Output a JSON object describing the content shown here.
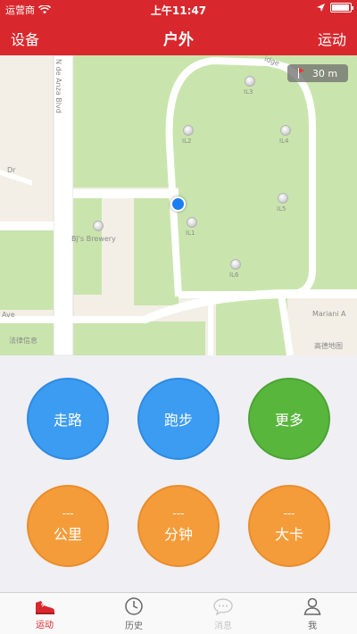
{
  "status_bar": {
    "carrier": "运营商",
    "time": "上午11:47"
  },
  "nav": {
    "left_label": "设备",
    "title": "户外",
    "right_label": "运动"
  },
  "map": {
    "scale_label": "30 m",
    "attribution": "高德地图",
    "street_labels": {
      "de_anza": "N de Anza Blvd",
      "dr": "Dr",
      "ave": "Ave",
      "mariani": "Mariani A",
      "ridge": "idge",
      "legal": "法律信息"
    },
    "pois": [
      {
        "label": "IL3"
      },
      {
        "label": "IL2"
      },
      {
        "label": "IL4"
      },
      {
        "label": "IL5"
      },
      {
        "label": "IL1"
      },
      {
        "label": "IL6"
      },
      {
        "label": "BJ's Brewery"
      }
    ]
  },
  "activity_buttons": {
    "walk": "走路",
    "run": "跑步",
    "more": "更多"
  },
  "stats": {
    "distance": {
      "value": "---",
      "unit": "公里"
    },
    "duration": {
      "value": "---",
      "unit": "分钟"
    },
    "calories": {
      "value": "---",
      "unit": "大卡"
    }
  },
  "tabs": {
    "sport": "运动",
    "history": "历史",
    "messages": "消息",
    "me": "我"
  },
  "colors": {
    "brand_red": "#d8282d",
    "walk_run_blue": "#3c9cf2",
    "more_green": "#59b63d",
    "stat_orange": "#f59c3a",
    "park_green": "#c9e5ad"
  }
}
